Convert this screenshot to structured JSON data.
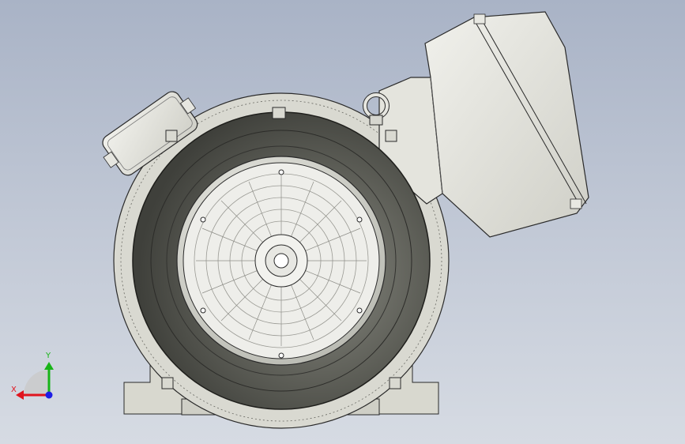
{
  "viewport": {
    "background_top": "#a9b3c6",
    "background_bottom": "#d6dbe3"
  },
  "model": {
    "body_color": "#d9d9d1",
    "fan_cover_color": "#5e5f58",
    "edge_color": "#2a2a2a",
    "icon": "motor-end-view"
  },
  "triad": {
    "x_label": "X",
    "y_label": "Y",
    "x_color": "#e0141e",
    "y_color": "#18b418",
    "z_color": "#1e1ee6"
  }
}
